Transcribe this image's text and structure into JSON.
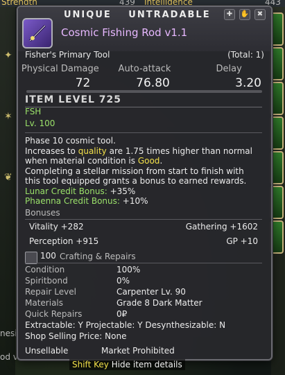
{
  "background": {
    "top_left_label": "Strength",
    "top_mid_value": "439",
    "top_right_label": "Intelligence",
    "top_right_value": "443",
    "left_bottom_a": "nesi",
    "left_bottom_b": "od v"
  },
  "tooltip": {
    "badges": [
      "UNIQUE",
      "UNTRADABLE"
    ],
    "item_name": "Cosmic Fishing Rod v1.1",
    "category": "Fisher's Primary Tool",
    "total": "(Total: 1)",
    "stats": {
      "headers": [
        "Physical Damage",
        "Auto-attack",
        "Delay"
      ],
      "values": [
        "72",
        "76.80",
        "3.20"
      ]
    },
    "item_level": "ITEM LEVEL 725",
    "job": "FSH",
    "level": "Lv. 100",
    "description": {
      "line1": "Phase 10 cosmic tool.",
      "line2_pre": "Increases to ",
      "line2_quality": "quality",
      "line2_post": " are 1.75 times higher than normal",
      "line3_pre": "when material condition is ",
      "line3_good": "Good",
      "line3_post": ".",
      "line4": "Completing a stellar mission from start to finish with",
      "line5": "this tool equipped grants a bonus to earned rewards.",
      "lunar_label": "Lunar Credit Bonus:",
      "lunar_value": " +35%",
      "phaenna_label": "Phaenna Credit Bonus:",
      "phaenna_value": " +10%"
    },
    "bonuses": {
      "title": "Bonuses",
      "vitality": "Vitality +282",
      "gathering": "Gathering +1602",
      "perception": "Perception +915",
      "gp": "GP +10"
    },
    "crafting": {
      "count": "100",
      "title": "Crafting & Repairs",
      "condition_label": "Condition",
      "condition_value": "100%",
      "spiritbond_label": "Spiritbond",
      "spiritbond_value": "0%",
      "repair_level_label": "Repair Level",
      "repair_level_value": "Carpenter Lv. 90",
      "materials_label": "Materials",
      "materials_value": "Grade 8 Dark Matter",
      "quick_repairs_label": "Quick Repairs",
      "quick_repairs_value": "0₽"
    },
    "flags": "Extractable: Y  Projectable: Y  Desynthesizable: N",
    "shop_price": "Shop Selling Price: None",
    "unsellable": "Unsellable",
    "market": "Market Prohibited"
  },
  "footer": {
    "key": "Shift Key",
    "action": "Hide item details"
  }
}
